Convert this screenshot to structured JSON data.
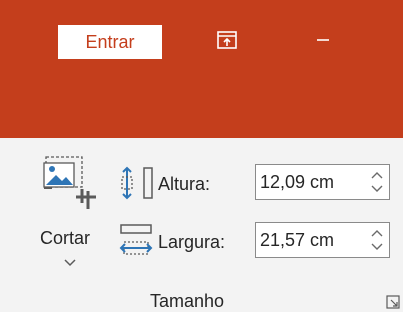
{
  "titlebar": {
    "signin_label": "Entrar",
    "restore_icon": "ribbon-display-options-icon",
    "minimize_icon": "minimize-icon",
    "accent_color": "#c43e1c"
  },
  "ribbon": {
    "crop": {
      "label": "Cortar",
      "icon": "crop-icon",
      "dropdown_icon": "chevron-down-icon"
    },
    "height": {
      "label": "Altura:",
      "value": "12,09 cm",
      "icon": "shape-height-icon"
    },
    "width": {
      "label": "Largura:",
      "value": "21,57 cm",
      "icon": "shape-width-icon"
    },
    "group_label": "Tamanho",
    "launcher_icon": "dialog-launcher-icon"
  }
}
